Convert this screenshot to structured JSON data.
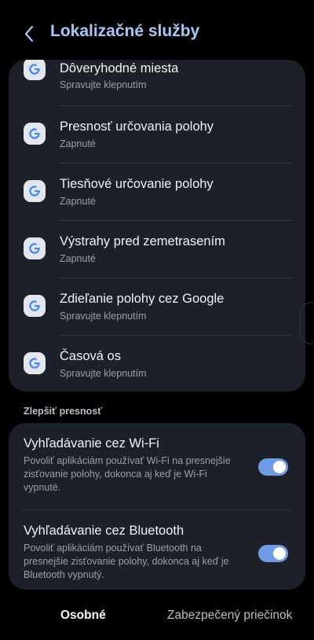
{
  "header": {
    "title": "Lokalizačné služby",
    "back_icon": "chevron-left-icon"
  },
  "apps": [
    {
      "icon": "google-icon",
      "title": "Dôveryhodné miesta",
      "subtitle": "Spravujte klepnutím"
    },
    {
      "icon": "google-icon",
      "title": "Presnosť určovania polohy",
      "subtitle": "Zapnuté"
    },
    {
      "icon": "google-icon",
      "title": "Tiesňové určovanie polohy",
      "subtitle": "Zapnuté"
    },
    {
      "icon": "google-icon",
      "title": "Výstrahy pred zemetrasením",
      "subtitle": "Zapnuté"
    },
    {
      "icon": "google-icon",
      "title": "Zdieľanie polohy cez Google",
      "subtitle": "Spravujte klepnutím"
    },
    {
      "icon": "google-icon",
      "title": "Časová os",
      "subtitle": "Spravujte klepnutím"
    }
  ],
  "accuracy": {
    "section_label": "Zlepšiť presnosť",
    "items": [
      {
        "title": "Vyhľadávanie cez Wi-Fi",
        "description": "Povoliť aplikáciám používať Wi-Fi na presnejšie zisťovanie polohy, dokonca aj keď je Wi-Fi vypnuté.",
        "enabled": true
      },
      {
        "title": "Vyhľadávanie cez Bluetooth",
        "description": "Povoliť aplikáciám používať Bluetooth na presnejšie zisťovanie polohy, dokonca aj keď je Bluetooth vypnutý.",
        "enabled": true
      }
    ]
  },
  "tabs": {
    "personal": "Osobné",
    "secure_folder": "Zabezpečený priečinok"
  },
  "colors": {
    "accent": "#a9c7f5",
    "toggle_on": "#6f9be6",
    "card_bg": "#1c2028",
    "background": "#000000"
  }
}
